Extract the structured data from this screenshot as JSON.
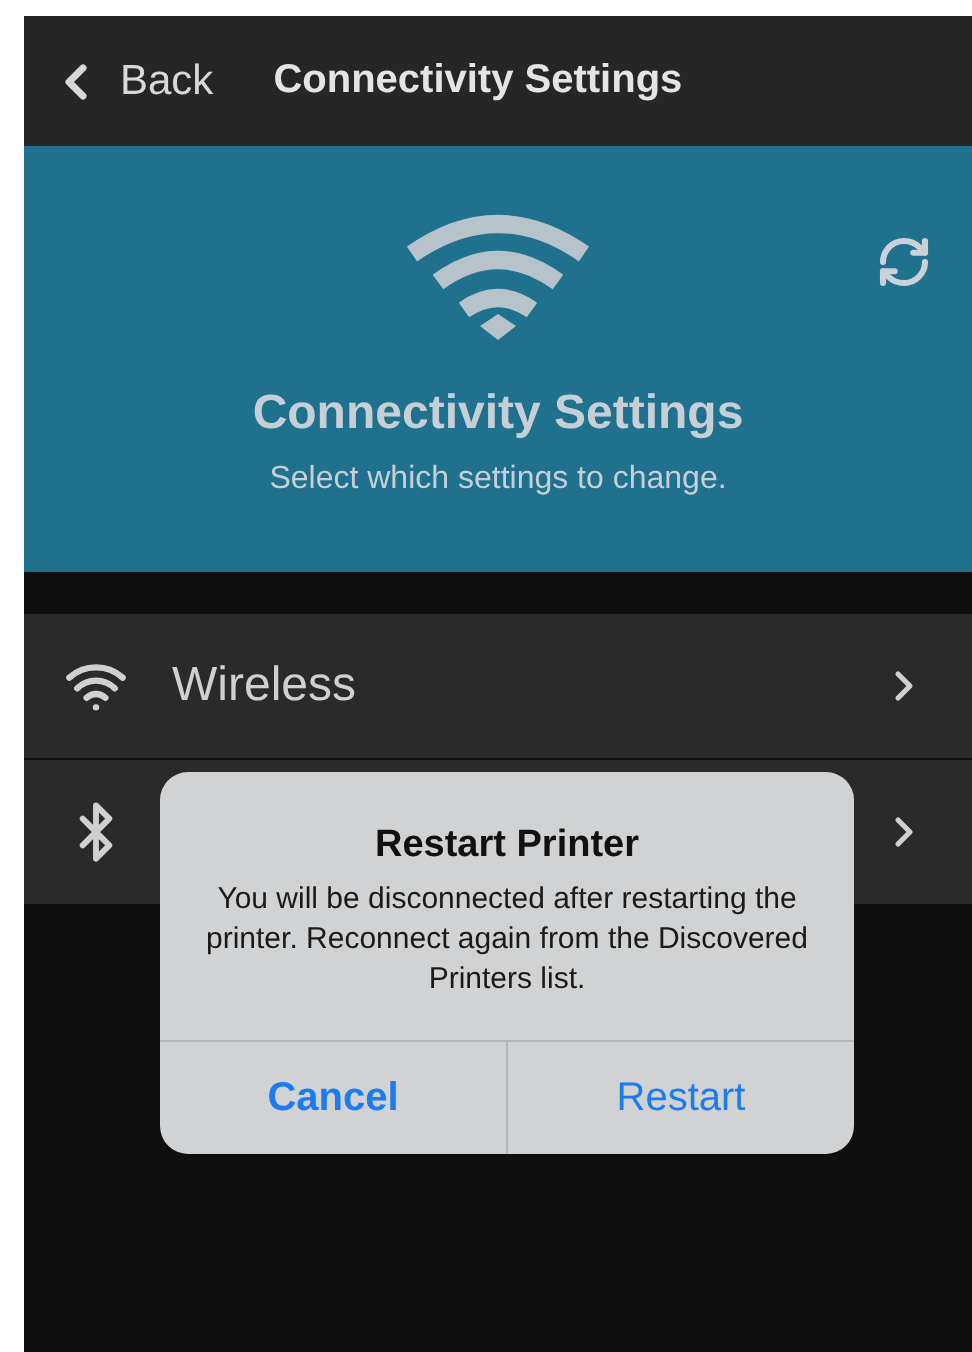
{
  "nav_bar": {
    "back_label": "Back",
    "title": "Connectivity Settings"
  },
  "header": {
    "title": "Connectivity Settings",
    "subtitle": "Select which settings to change."
  },
  "settings": [
    {
      "kind": "wifi",
      "label": "Wireless"
    },
    {
      "kind": "bluetooth"
    }
  ],
  "dialog": {
    "title": "Restart Printer",
    "message": "You will be disconnected after restarting the printer. Reconnect again from the Discovered Printers list.",
    "buttons": [
      {
        "label": "Cancel",
        "kind": "bold"
      },
      {
        "label": "Restart",
        "kind": "regular"
      }
    ]
  }
}
